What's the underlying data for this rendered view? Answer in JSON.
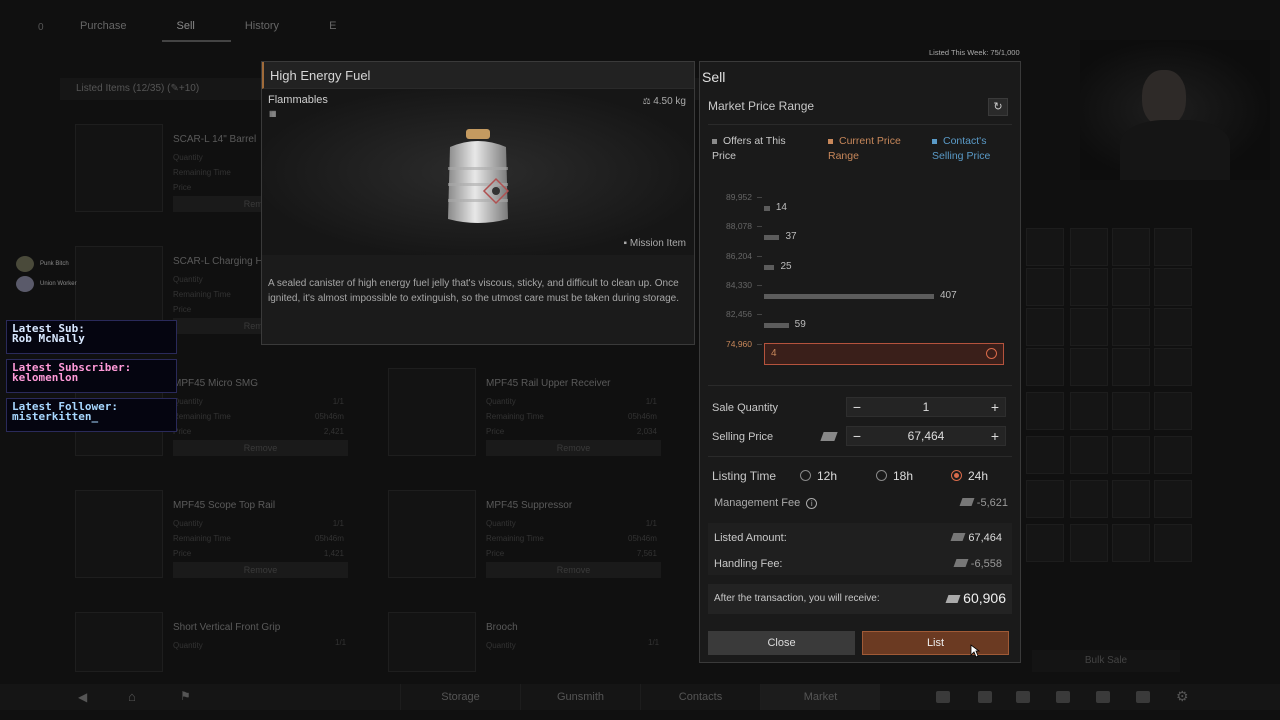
{
  "background": {
    "tabs": [
      "Purchase",
      "Sell",
      "History",
      "E"
    ],
    "listed_header": "Listed Items (12/35)  (✎+10)",
    "items": [
      {
        "name": "SCAR-L 14\" Barrel"
      },
      {
        "name": "SCAR-L Charging H"
      },
      {
        "name": "MPF45 Micro SMG",
        "price": "2,421"
      },
      {
        "name": "MPF45 Rail Upper Receiver",
        "price": "2,034"
      },
      {
        "name": "MPF45 Scope Top Rail",
        "price": "1,421"
      },
      {
        "name": "MPF45 Suppressor",
        "price": "7,561"
      },
      {
        "name": "Short Vertical Front Grip"
      },
      {
        "name": "Brooch"
      }
    ],
    "meta_labels": [
      "Quantity",
      "Remaining Time",
      "Price"
    ],
    "qty": "1/1",
    "time": "05h46m",
    "remove_label": "Remove",
    "bulk_sale": "Bulk Sale",
    "badges": [
      "Punk Bitch",
      "Union Worker"
    ]
  },
  "overlays": {
    "sub": [
      "Latest Sub:",
      "Rob McNally"
    ],
    "subscriber": [
      "Latest Subscriber:",
      "kelomenlon"
    ],
    "follower": [
      "Latest Follower:",
      "misterkitten_"
    ]
  },
  "bottom_nav": [
    "Storage",
    "Gunsmith",
    "Contacts",
    "Market"
  ],
  "item": {
    "title": "High Energy Fuel",
    "category": "Flammables",
    "weight": "4.50 kg",
    "tag": "Mission Item",
    "description": "A sealed canister of high energy fuel jelly that's viscous, sticky, and difficult to clean up. Once ignited, it's almost impossible to extinguish, so the utmost care must be taken during storage."
  },
  "sell": {
    "title": "Sell",
    "listed_week": "Listed This Week: 75/1,000",
    "market_price_range": "Market Price Range",
    "legend": [
      {
        "label": "Offers at This Price",
        "color": "#8a8a8a"
      },
      {
        "label": "Current Price Range",
        "color": "#c7875a"
      },
      {
        "label": "Contact's Selling Price",
        "color": "#5a9ac7"
      }
    ],
    "price_levels": [
      "89,952",
      "88,078",
      "86,204",
      "84,330",
      "82,456",
      "74,960"
    ],
    "offers": [
      14,
      37,
      25,
      407,
      59,
      4
    ],
    "sale_quantity_label": "Sale Quantity",
    "sale_quantity": "1",
    "selling_price_label": "Selling Price",
    "selling_price": "67,464",
    "listing_time_label": "Listing Time",
    "listing_options": [
      "12h",
      "18h",
      "24h"
    ],
    "listing_selected": "24h",
    "management_fee_label": "Management Fee",
    "management_fee": "-5,621",
    "listed_amount_label": "Listed Amount:",
    "listed_amount": "67,464",
    "handling_fee_label": "Handling Fee:",
    "handling_fee": "-6,558",
    "receive_label": "After the transaction, you will receive:",
    "receive_amount": "60,906",
    "close_label": "Close",
    "list_label": "List"
  },
  "colors": {
    "accent": "#c7875a",
    "list_button": "#6b3a22",
    "highlight_border": "#b5533d",
    "contact": "#5a9ac7"
  }
}
